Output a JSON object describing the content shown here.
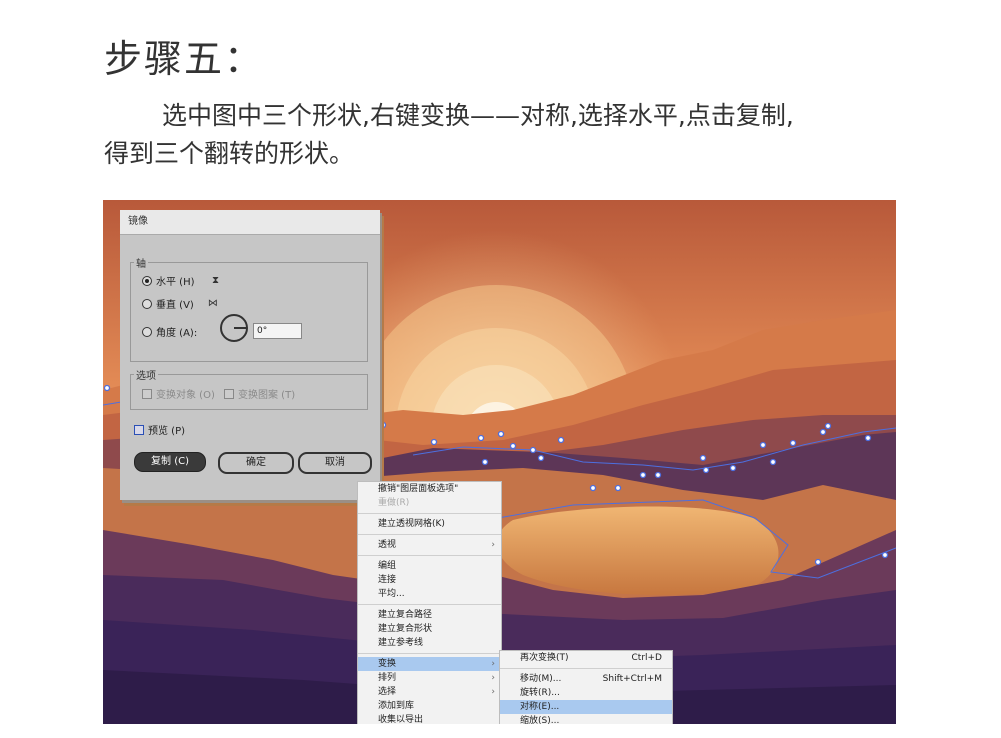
{
  "step_title": "步骤五：",
  "description": {
    "line1": "选中图中三个形状,右键变换——对称,选择水平,点击复制,",
    "line2": "得到三个翻转的形状。"
  },
  "dialog": {
    "title": "镜像",
    "axis_group_label": "轴",
    "horizontal_label": "水平 (H)",
    "vertical_label": "垂直 (V)",
    "angle_label": "角度 (A):",
    "angle_value": "0°",
    "options_group_label": "选项",
    "transform_objects_label": "变换对象 (O)",
    "transform_patterns_label": "变换图案 (T)",
    "preview_label": "预览 (P)",
    "copy_button": "复制 (C)",
    "ok_button": "确定",
    "cancel_button": "取消",
    "selected_axis": "horizontal"
  },
  "context_menu": {
    "items": [
      {
        "label": "撤销\"图层面板选项\"",
        "type": "item",
        "disabled": false
      },
      {
        "label": "重做(R)",
        "type": "item",
        "disabled": true
      },
      {
        "type": "sep"
      },
      {
        "label": "建立透视网格(K)",
        "type": "item"
      },
      {
        "type": "sep"
      },
      {
        "label": "透视",
        "type": "submenu"
      },
      {
        "type": "sep"
      },
      {
        "label": "编组",
        "type": "item"
      },
      {
        "label": "连接",
        "type": "item"
      },
      {
        "label": "平均...",
        "type": "item"
      },
      {
        "type": "sep"
      },
      {
        "label": "建立复合路径",
        "type": "item"
      },
      {
        "label": "建立复合形状",
        "type": "item"
      },
      {
        "label": "建立参考线",
        "type": "item"
      },
      {
        "type": "sep"
      },
      {
        "label": "变换",
        "type": "submenu",
        "highlighted": true
      },
      {
        "label": "排列",
        "type": "submenu"
      },
      {
        "label": "选择",
        "type": "submenu"
      },
      {
        "label": "添加到库",
        "type": "item"
      },
      {
        "label": "收集以导出",
        "type": "item"
      }
    ]
  },
  "transform_submenu": {
    "items": [
      {
        "label": "再次变换(T)",
        "shortcut": "Ctrl+D"
      },
      {
        "type": "sep"
      },
      {
        "label": "移动(M)...",
        "shortcut": "Shift+Ctrl+M"
      },
      {
        "label": "旋转(R)...",
        "shortcut": ""
      },
      {
        "label": "对称(E)...",
        "shortcut": "",
        "highlighted": true
      },
      {
        "label": "缩放(S)...",
        "shortcut": ""
      }
    ]
  },
  "colors": {
    "sky_top": "#b8593a",
    "sky_mid": "#e9995c",
    "sun": "#fdf3e2",
    "mountain_dark": "#3a2358",
    "selection": "#4d6fe0",
    "menu_highlight": "#a9c9ef"
  }
}
